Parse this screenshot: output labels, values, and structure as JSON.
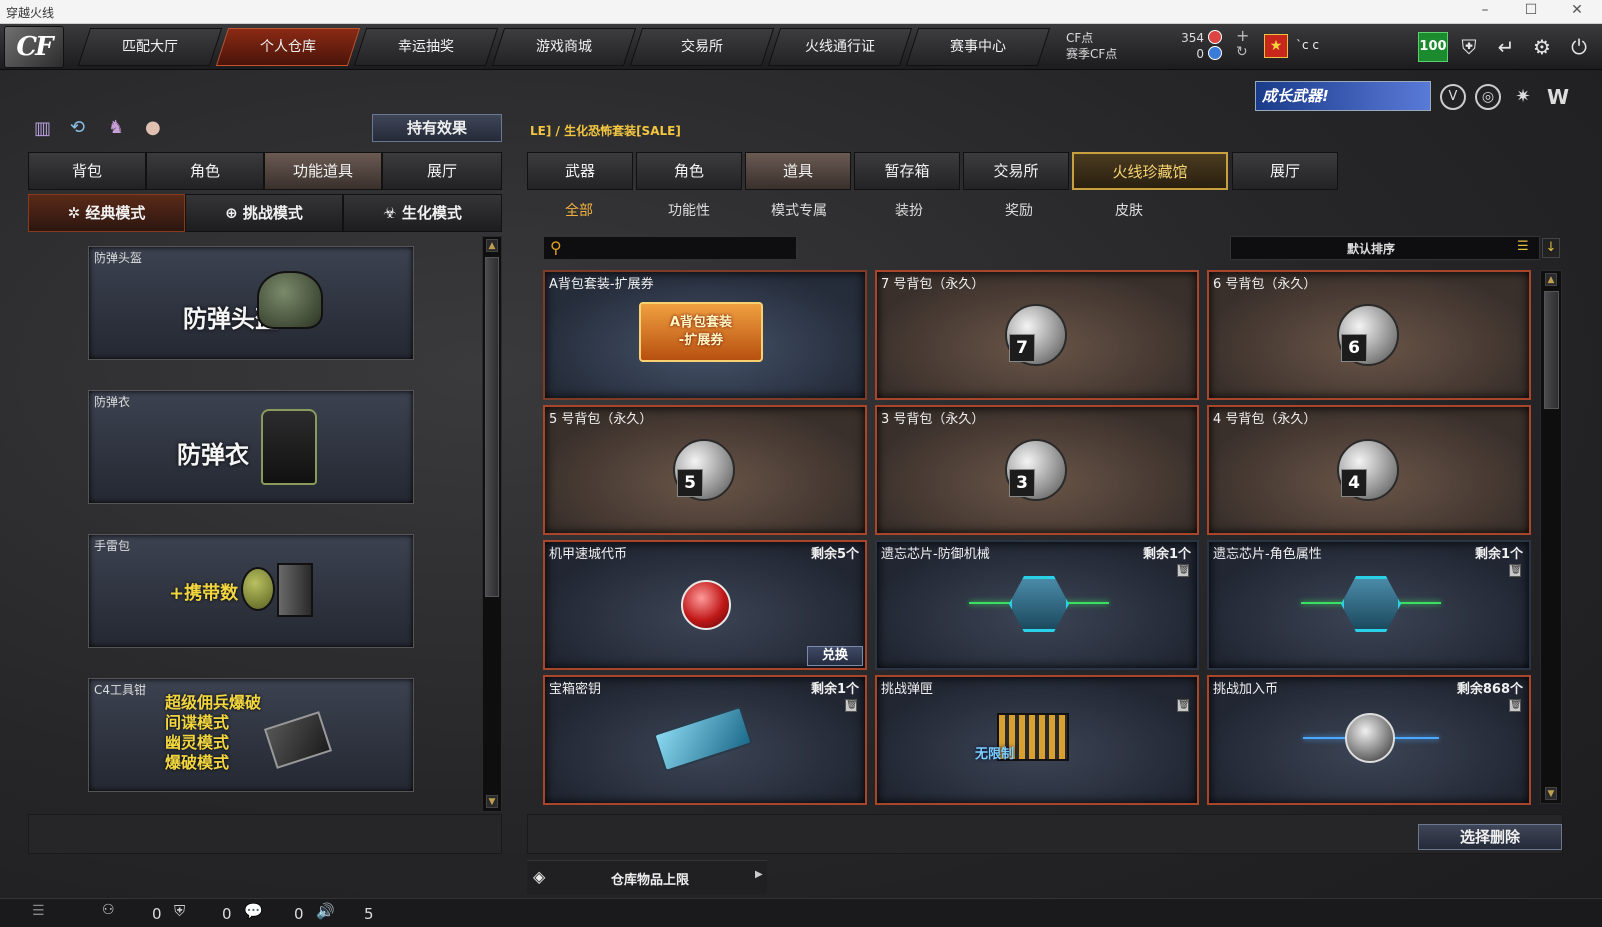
{
  "window": {
    "title": "穿越火线"
  },
  "nav": {
    "logo": "CF",
    "tabs": [
      "匹配大厅",
      "个人仓库",
      "幸运抽奖",
      "游戏商城",
      "交易所",
      "火线通行证",
      "赛事中心"
    ],
    "active_tab": "个人仓库",
    "cf_points_label": "CF点",
    "season_cf_label": "赛季CF点",
    "cf_points_value": "354",
    "season_cf_value": "0",
    "user_name": "`c c",
    "level_badge": "100"
  },
  "header": {
    "promo_banner": "成长武器!"
  },
  "left": {
    "effects_button": "持有效果",
    "tabs": [
      "背包",
      "角色",
      "功能道具",
      "展厅"
    ],
    "active_tab": "功能道具",
    "modes": [
      "经典模式",
      "挑战模式",
      "生化模式"
    ],
    "active_mode": "经典模式",
    "cards": [
      {
        "label": "防弹头盔",
        "title": "防弹头盔"
      },
      {
        "label": "防弹衣",
        "title": "防弹衣"
      },
      {
        "label": "手雷包",
        "title": "+携带数"
      },
      {
        "label": "C4工具钳",
        "lines": [
          "超级佣兵爆破",
          "间谍模式",
          "幽灵模式",
          "爆破模式"
        ]
      }
    ]
  },
  "right": {
    "breadcrumb": "LE] / 生化恐怖套装[SALE]",
    "tabs": [
      "武器",
      "角色",
      "道具",
      "暂存箱",
      "交易所",
      "火线珍藏馆",
      "展厅"
    ],
    "active_tab": "道具",
    "highlight_tab": "火线珍藏馆",
    "subtabs": [
      "全部",
      "功能性",
      "模式专属",
      "装扮",
      "奖励",
      "皮肤"
    ],
    "active_subtab": "全部",
    "search_placeholder": "",
    "sort_label": "默认排序",
    "items": [
      {
        "name": "A背包套装-扩展券",
        "count": "",
        "art": "A背包套装\n-扩展券"
      },
      {
        "name": "7 号背包（永久）",
        "count": "",
        "bag": "7"
      },
      {
        "name": "6 号背包（永久）",
        "count": "",
        "bag": "6"
      },
      {
        "name": "5 号背包（永久）",
        "count": "",
        "bag": "5"
      },
      {
        "name": "3 号背包（永久）",
        "count": "",
        "bag": "3"
      },
      {
        "name": "4 号背包（永久）",
        "count": "",
        "bag": "4"
      },
      {
        "name": "机甲速城代币",
        "count": "剩余5个",
        "action": "兑换"
      },
      {
        "name": "遗忘芯片-防御机械",
        "count": "剩余1个"
      },
      {
        "name": "遗忘芯片-角色属性",
        "count": "剩余1个"
      },
      {
        "name": "宝箱密钥",
        "count": "剩余1个"
      },
      {
        "name": "挑战弹匣",
        "count": "",
        "art": "无限制"
      },
      {
        "name": "挑战加入币",
        "count": "剩余868个"
      }
    ],
    "delete_button": "选择删除",
    "capacity_label": "仓库物品上限"
  },
  "statusbar": {
    "values": [
      "0",
      "0",
      "0",
      "5"
    ]
  }
}
